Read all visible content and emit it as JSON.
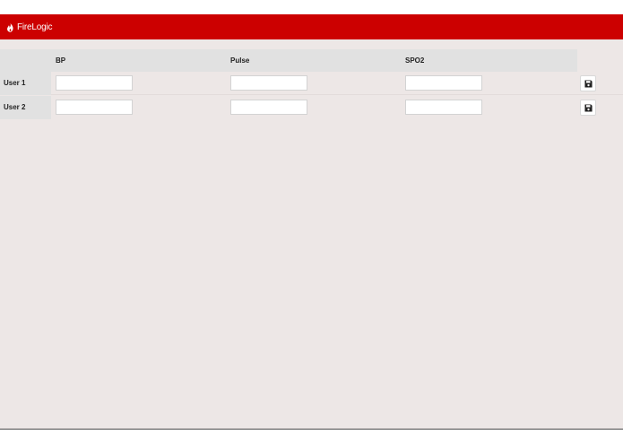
{
  "app": {
    "brand": "FireLogic",
    "brand_icon": "flame-icon",
    "accent_color": "#cc0000"
  },
  "table": {
    "columns": [
      {
        "label": "BP"
      },
      {
        "label": "Pulse"
      },
      {
        "label": "SPO2"
      }
    ],
    "rows": [
      {
        "label": "User 1",
        "bp": "",
        "pulse": "",
        "spo2": "",
        "save_icon": "floppy-disk-icon"
      },
      {
        "label": "User 2",
        "bp": "",
        "pulse": "",
        "spo2": "",
        "save_icon": "floppy-disk-icon"
      }
    ]
  }
}
